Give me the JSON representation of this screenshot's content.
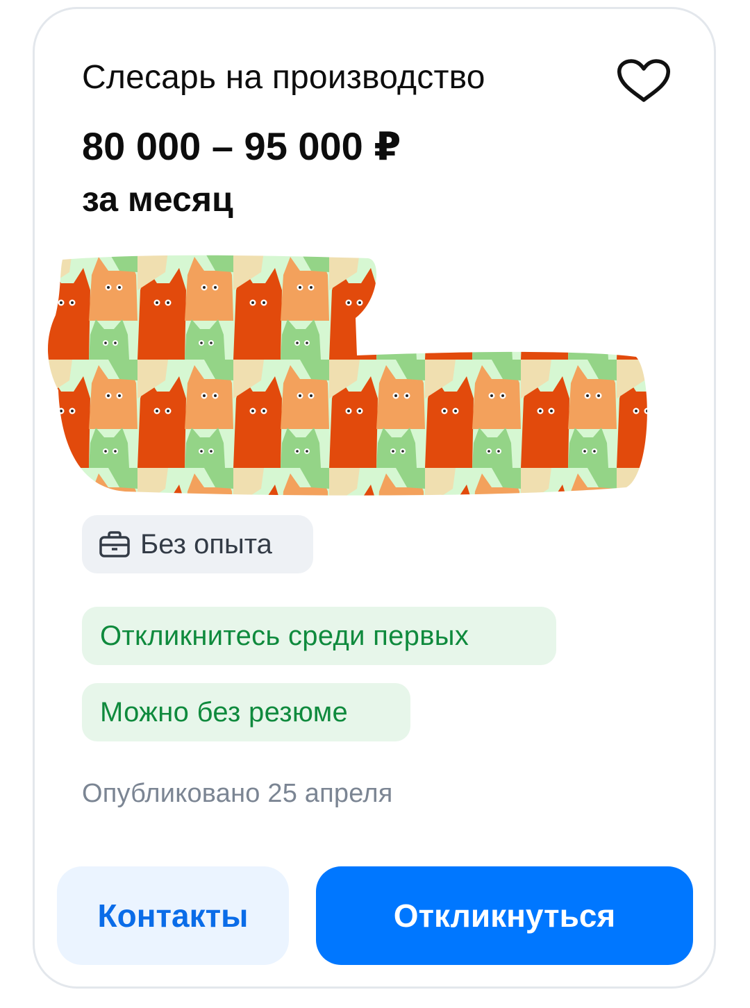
{
  "vacancy": {
    "title": "Слесарь на производство",
    "salary": "80 000 – 95 000 ₽",
    "period": "за месяц"
  },
  "icons": {
    "favorite": "heart-outline-icon",
    "experience": "briefcase-icon"
  },
  "tags": {
    "experience": "Без опыта",
    "respond_first": "Откликнитесь среди первых",
    "no_resume": "Можно без резюме"
  },
  "published": "Опубликовано 25 апреля",
  "buttons": {
    "contacts": "Контакты",
    "respond": "Откликнуться"
  },
  "colors": {
    "primary": "#0077ff",
    "primary_light": "#ebf4ff",
    "success_text": "#0f8a3d",
    "success_bg": "#e7f6ea",
    "muted_text": "#7b8593",
    "tag_bg": "#eef1f5"
  }
}
